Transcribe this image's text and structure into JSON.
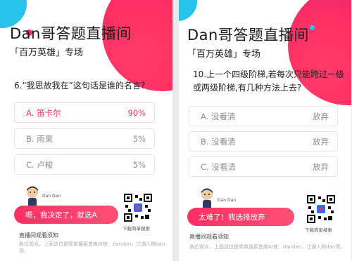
{
  "left": {
    "title": "Dan哥答题直播间",
    "subtitle": "「百万英雄」专场",
    "question": "6.“我思故我在”这句话是谁的名言?",
    "options": [
      {
        "label": "A. 笛卡尔",
        "value": "90%"
      },
      {
        "label": "B. 雨果",
        "value": "5%"
      },
      {
        "label": "C. 卢梭",
        "value": "5%"
      }
    ],
    "host_name": "Dan Dan",
    "bubble": "嗯，我决定了，就选A",
    "qr_caption": "下载简单搜索",
    "notice_title": "直播间观看须知",
    "notice_text": "各位观众，上面这位是简单搜索首席AI侠：dandan，江湖人称dan哥。"
  },
  "right": {
    "title": "Dan哥答题直播间",
    "subtitle": "「百万英雄」专场",
    "question": "10.上一个四级阶梯,若每次只能跨过一级或两级阶梯,有几种方法上去?",
    "options": [
      {
        "label": "A. 没看清",
        "value": "放弃"
      },
      {
        "label": "B. 没看清",
        "value": "放弃"
      },
      {
        "label": "C. 没看清",
        "value": "放弃"
      }
    ],
    "host_name": "Dan Dan",
    "bubble": "太难了！我选择放弃",
    "qr_caption": "下载简单搜索",
    "notice_title": "直播间观看须知",
    "notice_text": "各位观众，上面这位是简单搜索首席AI侠：dandan，江湖人称dan哥。"
  },
  "colors": {
    "accent": "#ff2f63",
    "cyan": "#27c3e8",
    "option_text": "#8d8d93"
  },
  "icons": [
    "host-avatar-icon",
    "qr-code-icon"
  ]
}
